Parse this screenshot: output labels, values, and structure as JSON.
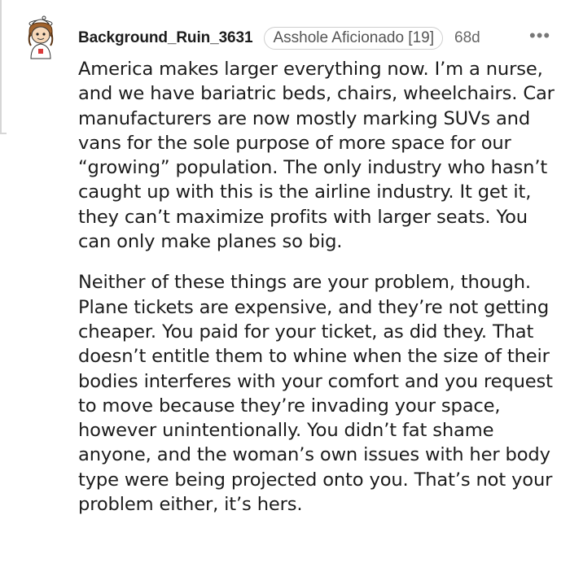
{
  "comment": {
    "username": "Background_Ruin_3631",
    "flair": "Asshole Aficionado [19]",
    "age": "68d",
    "more_label": "•••",
    "paragraphs": [
      "America makes larger everything now. I’m a nurse, and we have bariatric beds, chairs, wheelchairs. Car manufacturers are now mostly marking SUVs and vans for the sole purpose of more space for our “growing” population. The only industry who hasn’t caught up with this is the airline industry. It get it, they can’t maximize profits with larger seats. You can only make planes so big.",
      "Neither of these things are your problem, though. Plane tickets are expensive, and they’re not getting cheaper. You paid for your ticket, as did they. That doesn’t entitle them to whine when the size of their bodies interferes with your comfort and you request to move because they’re invading your space, however unintentionally. You didn’t fat shame anyone, and the woman’s own issues with her body type were being projected onto you. That’s not your problem either, it’s hers."
    ]
  },
  "colors": {
    "text": "#1c1c1c",
    "meta": "#666666",
    "flair_border": "#cfcfcf",
    "thread_line": "#d6d6d6"
  }
}
